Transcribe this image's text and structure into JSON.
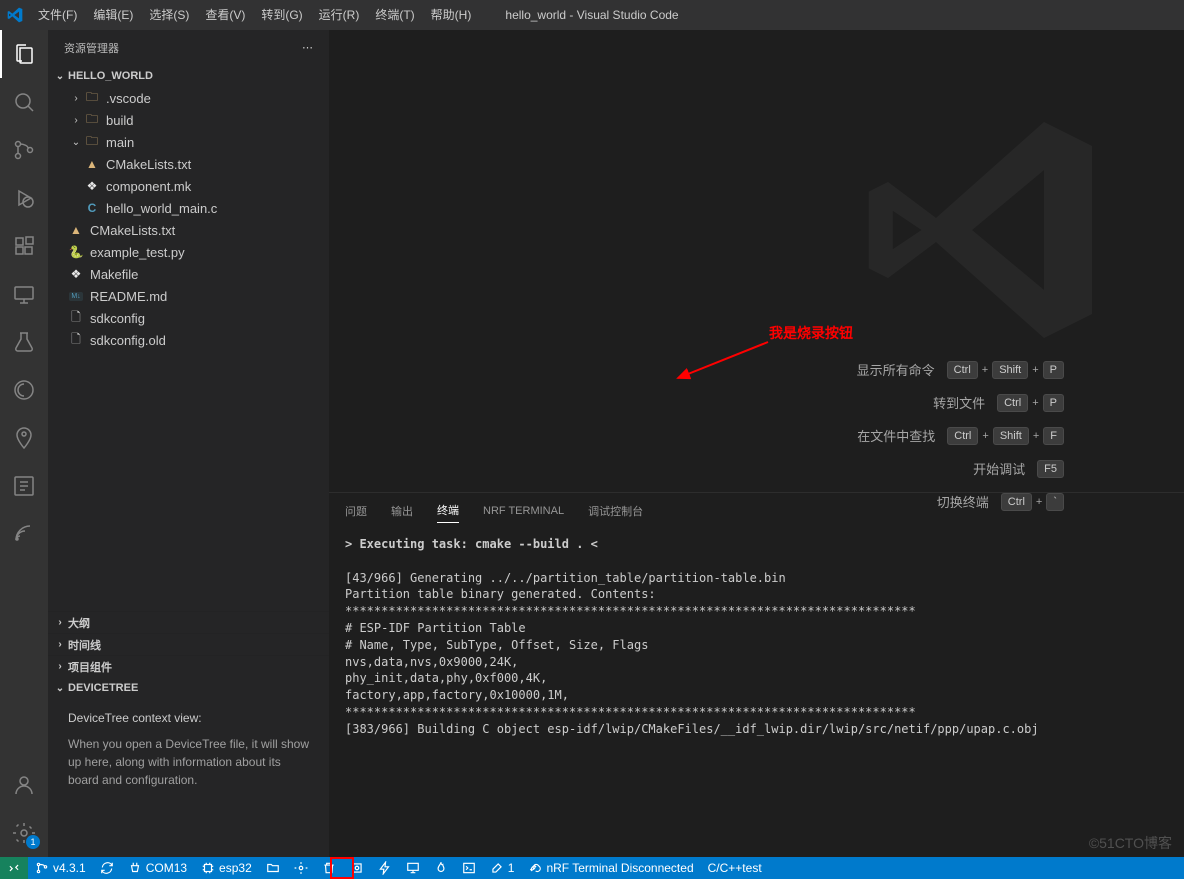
{
  "window_title": "hello_world - Visual Studio Code",
  "menu": [
    "文件(F)",
    "编辑(E)",
    "选择(S)",
    "查看(V)",
    "转到(G)",
    "运行(R)",
    "终端(T)",
    "帮助(H)"
  ],
  "sidebar": {
    "title": "资源管理器",
    "project": "HELLO_WORLD",
    "tree": [
      {
        "type": "folder",
        "name": ".vscode",
        "expanded": false,
        "depth": 1
      },
      {
        "type": "folder",
        "name": "build",
        "expanded": false,
        "depth": 1
      },
      {
        "type": "folder",
        "name": "main",
        "expanded": true,
        "depth": 1
      },
      {
        "type": "file",
        "name": "CMakeLists.txt",
        "icon": "cmake",
        "depth": 2
      },
      {
        "type": "file",
        "name": "component.mk",
        "icon": "mk",
        "depth": 2
      },
      {
        "type": "file",
        "name": "hello_world_main.c",
        "icon": "c",
        "depth": 2
      },
      {
        "type": "file",
        "name": "CMakeLists.txt",
        "icon": "cmake",
        "depth": 1
      },
      {
        "type": "file",
        "name": "example_test.py",
        "icon": "py",
        "depth": 1
      },
      {
        "type": "file",
        "name": "Makefile",
        "icon": "mk",
        "depth": 1
      },
      {
        "type": "file",
        "name": "README.md",
        "icon": "md",
        "depth": 1
      },
      {
        "type": "file",
        "name": "sdkconfig",
        "icon": "generic",
        "depth": 1
      },
      {
        "type": "file",
        "name": "sdkconfig.old",
        "icon": "generic",
        "depth": 1
      }
    ],
    "sections": [
      {
        "label": "大纲",
        "expanded": false
      },
      {
        "label": "时间线",
        "expanded": false
      },
      {
        "label": "项目组件",
        "expanded": false
      },
      {
        "label": "DEVICETREE",
        "expanded": true
      }
    ],
    "devicetree": {
      "heading": "DeviceTree context view:",
      "body": "When you open a DeviceTree file, it will show up here, along with information about its board and configuration."
    }
  },
  "welcome": {
    "shortcuts": [
      {
        "label": "显示所有命令",
        "keys": [
          "Ctrl",
          "+",
          "Shift",
          "+",
          "P"
        ]
      },
      {
        "label": "转到文件",
        "keys": [
          "Ctrl",
          "+",
          "P"
        ]
      },
      {
        "label": "在文件中查找",
        "keys": [
          "Ctrl",
          "+",
          "Shift",
          "+",
          "F"
        ]
      },
      {
        "label": "开始调试",
        "keys": [
          "F5"
        ]
      },
      {
        "label": "切换终端",
        "keys": [
          "Ctrl",
          "+",
          "`"
        ]
      }
    ]
  },
  "panel": {
    "tabs": [
      "问题",
      "输出",
      "终端",
      "NRF TERMINAL",
      "调试控制台"
    ],
    "active_tab": 2,
    "terminal_output": "> Executing task: cmake --build . <\n\n[43/966] Generating ../../partition_table/partition-table.bin\nPartition table binary generated. Contents:\n*******************************************************************************\n# ESP-IDF Partition Table\n# Name, Type, SubType, Offset, Size, Flags\nnvs,data,nvs,0x9000,24K,\nphy_init,data,phy,0xf000,4K,\nfactory,app,factory,0x10000,1M,\n*******************************************************************************\n[383/966] Building C object esp-idf/lwip/CMakeFiles/__idf_lwip.dir/lwip/src/netif/ppp/upap.c.obj"
  },
  "annotation": "我是烧录按钮",
  "statusbar": {
    "items_left": [
      {
        "icon": "remote",
        "label": ""
      },
      {
        "icon": "branch",
        "label": "v4.3.1"
      },
      {
        "icon": "sync",
        "label": ""
      },
      {
        "icon": "plug",
        "label": "COM13"
      },
      {
        "icon": "chip",
        "label": "esp32"
      },
      {
        "icon": "folder",
        "label": ""
      },
      {
        "icon": "gear",
        "label": ""
      },
      {
        "icon": "trash",
        "label": ""
      },
      {
        "icon": "build",
        "label": ""
      },
      {
        "icon": "flash",
        "label": ""
      },
      {
        "icon": "monitor",
        "label": ""
      },
      {
        "icon": "flame",
        "label": ""
      },
      {
        "icon": "terminal",
        "label": ""
      },
      {
        "icon": "tools",
        "label": "1"
      },
      {
        "icon": "link",
        "label": "nRF Terminal Disconnected"
      },
      {
        "icon": "",
        "label": "C/C++test"
      }
    ]
  },
  "watermark": "©51CTO博客",
  "settings_badge": "1"
}
